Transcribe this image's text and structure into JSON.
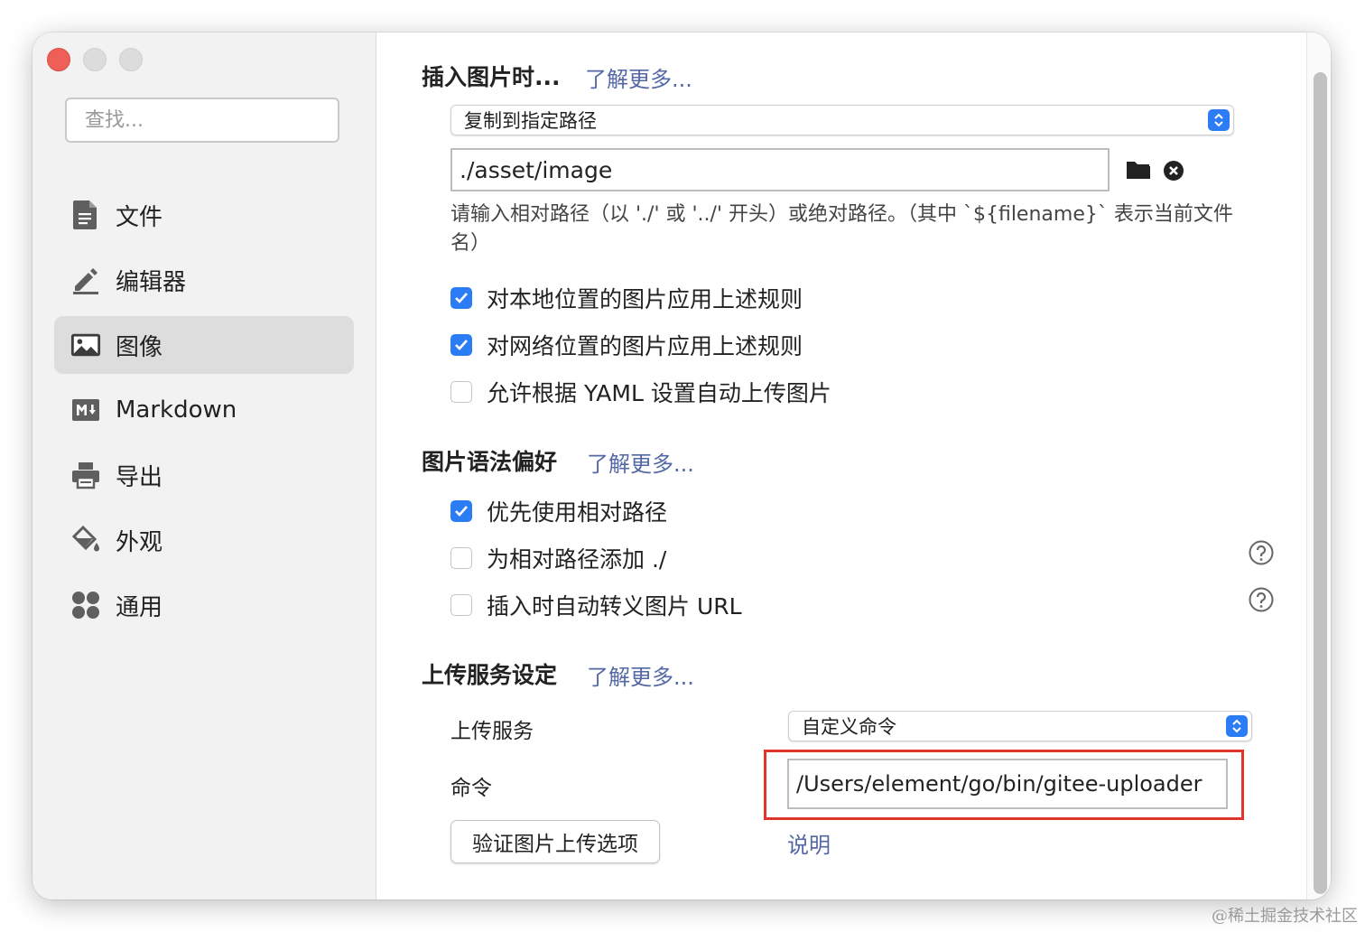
{
  "sidebar": {
    "search_placeholder": "查找...",
    "items": [
      {
        "label": "文件",
        "icon": "file-icon"
      },
      {
        "label": "编辑器",
        "icon": "pencil-icon"
      },
      {
        "label": "图像",
        "icon": "image-icon",
        "active": true
      },
      {
        "label": "Markdown",
        "icon": "markdown-icon"
      },
      {
        "label": "导出",
        "icon": "printer-icon"
      },
      {
        "label": "外观",
        "icon": "paint-bucket-icon"
      },
      {
        "label": "通用",
        "icon": "grid-icon"
      }
    ]
  },
  "insert_section": {
    "title": "插入图片时...",
    "learn_more": "了解更多...",
    "action_select": "复制到指定路径",
    "path_value": "./asset/image",
    "hint": "请输入相对路径（以 './' 或 '../' 开头）或绝对路径。（其中 `${filename}` 表示当前文件名）",
    "checkboxes": [
      {
        "label": "对本地位置的图片应用上述规则",
        "checked": true
      },
      {
        "label": "对网络位置的图片应用上述规则",
        "checked": true
      },
      {
        "label": "允许根据 YAML 设置自动上传图片",
        "checked": false
      }
    ]
  },
  "syntax_section": {
    "title": "图片语法偏好",
    "learn_more": "了解更多...",
    "checkboxes": [
      {
        "label": "优先使用相对路径",
        "checked": true
      },
      {
        "label": "为相对路径添加 ./",
        "checked": false
      },
      {
        "label": "插入时自动转义图片 URL",
        "checked": false
      }
    ]
  },
  "upload_section": {
    "title": "上传服务设定",
    "learn_more": "了解更多...",
    "service_label": "上传服务",
    "service_value": "自定义命令",
    "command_label": "命令",
    "command_value": "/Users/element/go/bin/gitee-uploader",
    "verify_button": "验证图片上传选项",
    "explain_link": "说明"
  },
  "colors": {
    "accent": "#2c7df5",
    "link": "#5468a5",
    "highlight_box": "#e0352b",
    "close_button": "#ee5f57"
  },
  "watermark": "@稀土掘金技术社区"
}
